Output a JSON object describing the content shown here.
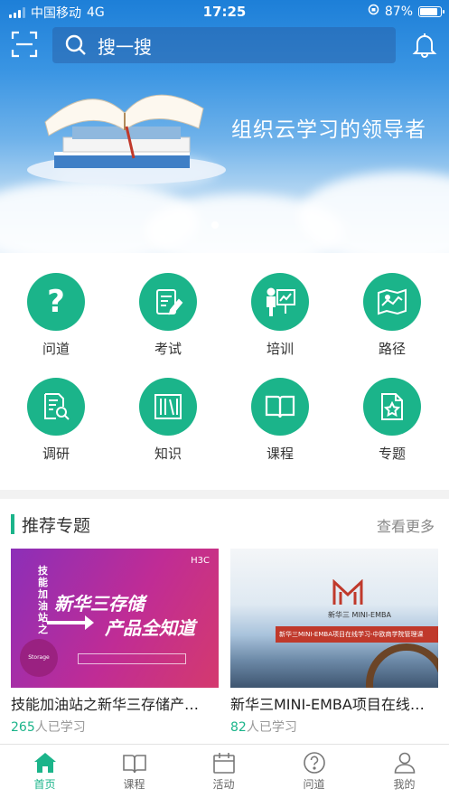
{
  "status": {
    "carrier": "中国移动",
    "network": "4G",
    "time": "17:25",
    "battery": "87%",
    "battery_level": 0.87
  },
  "header": {
    "search_placeholder": "搜一搜"
  },
  "banner": {
    "slogan": "组织云学习的领导者"
  },
  "menu": [
    {
      "label": "问道",
      "icon": "question-icon"
    },
    {
      "label": "考试",
      "icon": "exam-icon"
    },
    {
      "label": "培训",
      "icon": "training-icon"
    },
    {
      "label": "路径",
      "icon": "map-path-icon"
    },
    {
      "label": "调研",
      "icon": "survey-icon"
    },
    {
      "label": "知识",
      "icon": "books-icon"
    },
    {
      "label": "课程",
      "icon": "open-book-icon"
    },
    {
      "label": "专题",
      "icon": "topic-star-icon"
    }
  ],
  "recommend": {
    "title": "推荐专题",
    "more": "查看更多",
    "cards": [
      {
        "title": "技能加油站之新华三存储产…",
        "count": "265",
        "suffix": "人已学习",
        "art": {
          "vertical": "技能加油站之",
          "line1": "新华三存储",
          "line2": "产品全知道",
          "logo": "H3C",
          "badge": "Storage"
        }
      },
      {
        "title": "新华三MINI-EMBA项目在线…",
        "count": "82",
        "suffix": "人已学习",
        "art": {
          "logo_text": "新华三 MINI-EMBA",
          "banner": "新华三MINI-EMBA项目在线学习-中欧商学院管理课"
        }
      }
    ]
  },
  "tabs": [
    {
      "label": "首页",
      "icon": "home-icon",
      "active": true
    },
    {
      "label": "课程",
      "icon": "course-book-icon",
      "active": false
    },
    {
      "label": "活动",
      "icon": "calendar-icon",
      "active": false
    },
    {
      "label": "问道",
      "icon": "question-circle-icon",
      "active": false
    },
    {
      "label": "我的",
      "icon": "person-icon",
      "active": false
    }
  ],
  "colors": {
    "accent": "#1bb48a",
    "hero_top": "#1d7fd8"
  }
}
